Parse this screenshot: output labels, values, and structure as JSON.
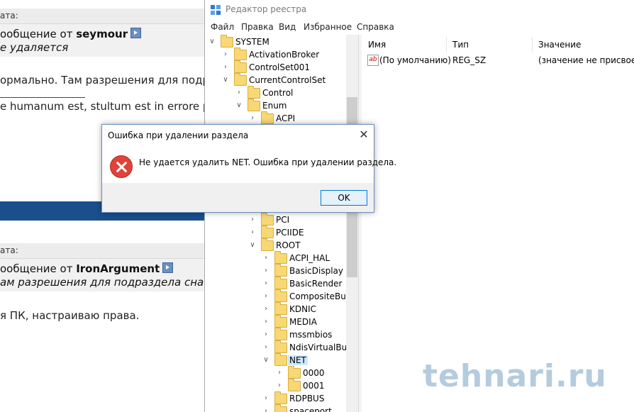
{
  "forum": {
    "quote1_header": "ата:",
    "quote1_from_prefix": "ообщение от ",
    "quote1_author": "seymour",
    "quote1_text": "е удаляется",
    "post1_text": "ормально. Там разрешения для подра",
    "post1_signature": "e humanum est, stultum est in errore pe",
    "quote2_header": "ата:",
    "quote2_from_prefix": "ообщение от ",
    "quote2_author": "IronArgument",
    "quote2_text": "ам разрешения для подраздела снача",
    "post2_text": "я ПК, настраиваю права."
  },
  "regedit": {
    "title": "Редактор реестра",
    "menu": [
      "Файл",
      "Правка",
      "Вид",
      "Избранное",
      "Справка"
    ],
    "tree": [
      {
        "label": "SYSTEM",
        "expander": "expanded"
      },
      {
        "label": "ActivationBroker",
        "expander": "collapsed"
      },
      {
        "label": "ControlSet001",
        "expander": "collapsed"
      },
      {
        "label": "CurrentControlSet",
        "expander": "expanded"
      },
      {
        "label": "Control",
        "expander": "collapsed"
      },
      {
        "label": "Enum",
        "expander": "expanded"
      },
      {
        "label": "ACPI",
        "expander": "collapsed"
      },
      {
        "label": "PCI",
        "expander": "collapsed"
      },
      {
        "label": "PCIIDE",
        "expander": "collapsed"
      },
      {
        "label": "ROOT",
        "expander": "expanded"
      },
      {
        "label": "ACPI_HAL",
        "expander": "collapsed"
      },
      {
        "label": "BasicDisplay",
        "expander": "collapsed"
      },
      {
        "label": "BasicRender",
        "expander": "collapsed"
      },
      {
        "label": "CompositeBus",
        "expander": "collapsed"
      },
      {
        "label": "KDNIC",
        "expander": "collapsed"
      },
      {
        "label": "MEDIA",
        "expander": "collapsed"
      },
      {
        "label": "mssmbios",
        "expander": "collapsed"
      },
      {
        "label": "NdisVirtualBus",
        "expander": "collapsed"
      },
      {
        "label": "NET",
        "expander": "expanded",
        "selected": true
      },
      {
        "label": "0000",
        "expander": "collapsed"
      },
      {
        "label": "0001",
        "expander": "collapsed"
      },
      {
        "label": "RDPBUS",
        "expander": "collapsed"
      },
      {
        "label": "spaceport",
        "expander": "collapsed"
      }
    ],
    "columns": {
      "name": "Имя",
      "type": "Тип",
      "value": "Значение"
    },
    "values": [
      {
        "name": "(По умолчанию)",
        "type": "REG_SZ",
        "value": "(значение не присвоено)",
        "icon": "ab-string-icon"
      }
    ]
  },
  "dialog": {
    "title": "Ошибка при удалении раздела",
    "message": "Не удается удалить NET.  Ошибка при удалении раздела.",
    "ok_label": "OK",
    "icon": "error-icon"
  },
  "watermark": "tehnari.ru",
  "colors": {
    "selection": "#cce8ff",
    "folder": "#f8d775",
    "error": "#e0433a",
    "forum_bar": "#1a4f8b"
  }
}
